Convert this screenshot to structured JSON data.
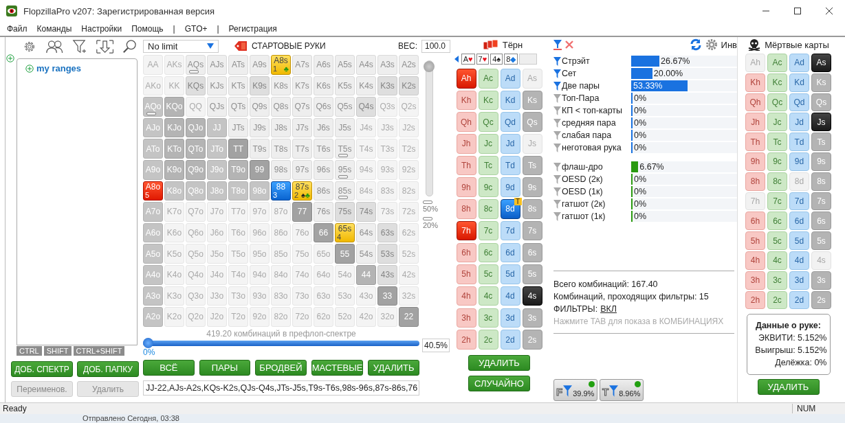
{
  "window": {
    "title": "FlopzillaPro v207: Зарегистрированная версия"
  },
  "menu": [
    "Файл",
    "Команды",
    "Настройки",
    "Помощь",
    "|",
    "GTO+",
    "|",
    "Регистрация"
  ],
  "range_panel": {
    "tree": [
      {
        "label": "my ranges"
      }
    ],
    "modifier_tabs": [
      "CTRL",
      "SHIFT",
      "CTRL+SHIFT"
    ],
    "buttons": [
      {
        "label": "ДОБ. СПЕКТР",
        "disabled": false
      },
      {
        "label": "ДОБ. ПАПКУ",
        "disabled": false
      },
      {
        "label": "Переименов.",
        "disabled": true
      },
      {
        "label": "Удалить",
        "disabled": true
      }
    ]
  },
  "grid": {
    "game": "No limit",
    "title": "СТАРТОВЫЕ РУКИ",
    "weight_label": "ВЕС:",
    "weight": "100.0",
    "weight_slider": {
      "level": 1,
      "marks": [
        "50%",
        "20%"
      ]
    },
    "rows": [
      [
        {
          "label": "AA",
          "kind": "faint",
          "marked": false
        },
        {
          "label": "AKs",
          "kind": "faint",
          "marked": false
        },
        {
          "label": "AQs",
          "kind": "light",
          "marked": true
        },
        {
          "label": "AJs",
          "kind": "light",
          "marked": false
        },
        {
          "label": "ATs",
          "kind": "light",
          "marked": false
        },
        {
          "label": "A9s",
          "kind": "light",
          "marked": false
        },
        {
          "label": "A8s",
          "kind": "yellow",
          "marked": false,
          "count": "1",
          "suits": [
            {
              "symbol": "♣",
              "color": "#2a9a10"
            }
          ]
        },
        {
          "label": "A7s",
          "kind": "light",
          "marked": false
        },
        {
          "label": "A6s",
          "kind": "light",
          "marked": false
        },
        {
          "label": "A5s",
          "kind": "light",
          "marked": false
        },
        {
          "label": "A4s",
          "kind": "light",
          "marked": false
        },
        {
          "label": "A3s",
          "kind": "light",
          "marked": false
        },
        {
          "label": "A2s",
          "kind": "light",
          "marked": false
        }
      ],
      [
        {
          "label": "AKo",
          "kind": "faint",
          "marked": false
        },
        {
          "label": "KK",
          "kind": "faint",
          "marked": false
        },
        {
          "label": "KQs",
          "kind": "shaded",
          "marked": false
        },
        {
          "label": "KJs",
          "kind": "light",
          "marked": false
        },
        {
          "label": "KTs",
          "kind": "light",
          "marked": false
        },
        {
          "label": "K9s",
          "kind": "shaded",
          "marked": false
        },
        {
          "label": "K8s",
          "kind": "light",
          "marked": false
        },
        {
          "label": "K7s",
          "kind": "light",
          "marked": false
        },
        {
          "label": "K6s",
          "kind": "light",
          "marked": false
        },
        {
          "label": "K5s",
          "kind": "light",
          "marked": false
        },
        {
          "label": "K4s",
          "kind": "light",
          "marked": false
        },
        {
          "label": "K3s",
          "kind": "shaded",
          "marked": false
        },
        {
          "label": "K2s",
          "kind": "shaded",
          "marked": false
        }
      ],
      [
        {
          "label": "AQo",
          "kind": "grey",
          "marked": true
        },
        {
          "label": "KQo",
          "kind": "dark",
          "marked": false
        },
        {
          "label": "QQ",
          "kind": "faint",
          "marked": false
        },
        {
          "label": "QJs",
          "kind": "light",
          "marked": false
        },
        {
          "label": "QTs",
          "kind": "light",
          "marked": false
        },
        {
          "label": "Q9s",
          "kind": "light",
          "marked": false
        },
        {
          "label": "Q8s",
          "kind": "light",
          "marked": false
        },
        {
          "label": "Q7s",
          "kind": "light",
          "marked": false
        },
        {
          "label": "Q6s",
          "kind": "light",
          "marked": false
        },
        {
          "label": "Q5s",
          "kind": "light",
          "marked": false
        },
        {
          "label": "Q4s",
          "kind": "shaded",
          "marked": false
        },
        {
          "label": "Q3s",
          "kind": "faint",
          "marked": false
        },
        {
          "label": "Q2s",
          "kind": "faint",
          "marked": false
        }
      ],
      [
        {
          "label": "AJo",
          "kind": "grey",
          "marked": false
        },
        {
          "label": "KJo",
          "kind": "dark",
          "marked": false
        },
        {
          "label": "QJo",
          "kind": "dark",
          "marked": false
        },
        {
          "label": "JJ",
          "kind": "grey",
          "marked": false
        },
        {
          "label": "JTs",
          "kind": "light",
          "marked": false
        },
        {
          "label": "J9s",
          "kind": "light",
          "marked": false
        },
        {
          "label": "J8s",
          "kind": "light",
          "marked": false
        },
        {
          "label": "J7s",
          "kind": "light",
          "marked": false
        },
        {
          "label": "J6s",
          "kind": "light",
          "marked": false
        },
        {
          "label": "J5s",
          "kind": "light",
          "marked": false
        },
        {
          "label": "J4s",
          "kind": "faint",
          "marked": false
        },
        {
          "label": "J3s",
          "kind": "faint",
          "marked": false
        },
        {
          "label": "J2s",
          "kind": "faint",
          "marked": false
        }
      ],
      [
        {
          "label": "ATo",
          "kind": "grey",
          "marked": false
        },
        {
          "label": "KTo",
          "kind": "dark",
          "marked": false
        },
        {
          "label": "QTo",
          "kind": "dark",
          "marked": false
        },
        {
          "label": "JTo",
          "kind": "grey",
          "marked": false
        },
        {
          "label": "TT",
          "kind": "darker",
          "marked": false
        },
        {
          "label": "T9s",
          "kind": "light",
          "marked": false
        },
        {
          "label": "T8s",
          "kind": "light",
          "marked": false
        },
        {
          "label": "T7s",
          "kind": "light",
          "marked": false
        },
        {
          "label": "T6s",
          "kind": "light",
          "marked": false
        },
        {
          "label": "T5s",
          "kind": "light",
          "marked": true
        },
        {
          "label": "T4s",
          "kind": "faint",
          "marked": false
        },
        {
          "label": "T3s",
          "kind": "faint",
          "marked": false
        },
        {
          "label": "T2s",
          "kind": "faint",
          "marked": false
        }
      ],
      [
        {
          "label": "A9o",
          "kind": "grey",
          "marked": false
        },
        {
          "label": "K9o",
          "kind": "dark",
          "marked": false
        },
        {
          "label": "Q9o",
          "kind": "dark",
          "marked": false
        },
        {
          "label": "J9o",
          "kind": "grey",
          "marked": false
        },
        {
          "label": "T9o",
          "kind": "dark",
          "marked": false
        },
        {
          "label": "99",
          "kind": "darker",
          "marked": false
        },
        {
          "label": "98s",
          "kind": "light",
          "marked": false
        },
        {
          "label": "97s",
          "kind": "light",
          "marked": false
        },
        {
          "label": "96s",
          "kind": "light",
          "marked": false
        },
        {
          "label": "95s",
          "kind": "light",
          "marked": true
        },
        {
          "label": "94s",
          "kind": "faint",
          "marked": false
        },
        {
          "label": "93s",
          "kind": "faint",
          "marked": false
        },
        {
          "label": "92s",
          "kind": "faint",
          "marked": false
        }
      ],
      [
        {
          "label": "A8o",
          "kind": "red",
          "marked": false,
          "count": "5"
        },
        {
          "label": "K8o",
          "kind": "grey",
          "marked": false
        },
        {
          "label": "Q8o",
          "kind": "grey",
          "marked": false
        },
        {
          "label": "J8o",
          "kind": "grey",
          "marked": false
        },
        {
          "label": "T8o",
          "kind": "grey",
          "marked": false
        },
        {
          "label": "98o",
          "kind": "grey",
          "marked": false
        },
        {
          "label": "88",
          "kind": "blue",
          "marked": false,
          "count": "3"
        },
        {
          "label": "87s",
          "kind": "yellow",
          "marked": false,
          "count": "2",
          "suits": [
            {
              "symbol": "♠",
              "color": "#222222"
            },
            {
              "symbol": "♣",
              "color": "#2a9a10"
            }
          ]
        },
        {
          "label": "86s",
          "kind": "light",
          "marked": false
        },
        {
          "label": "85s",
          "kind": "light",
          "marked": true
        },
        {
          "label": "84s",
          "kind": "faint",
          "marked": false
        },
        {
          "label": "83s",
          "kind": "faint",
          "marked": false
        },
        {
          "label": "82s",
          "kind": "faint",
          "marked": false
        }
      ],
      [
        {
          "label": "A7o",
          "kind": "grey",
          "marked": false
        },
        {
          "label": "K7o",
          "kind": "faint",
          "marked": false
        },
        {
          "label": "Q7o",
          "kind": "faint",
          "marked": false
        },
        {
          "label": "J7o",
          "kind": "faint",
          "marked": false
        },
        {
          "label": "T7o",
          "kind": "faint",
          "marked": false
        },
        {
          "label": "97o",
          "kind": "faint",
          "marked": false
        },
        {
          "label": "87o",
          "kind": "faint",
          "marked": false
        },
        {
          "label": "77",
          "kind": "darker",
          "marked": false
        },
        {
          "label": "76s",
          "kind": "light",
          "marked": false
        },
        {
          "label": "75s",
          "kind": "shaded",
          "marked": false
        },
        {
          "label": "74s",
          "kind": "shaded",
          "marked": false
        },
        {
          "label": "73s",
          "kind": "faint",
          "marked": false
        },
        {
          "label": "72s",
          "kind": "faint",
          "marked": false
        }
      ],
      [
        {
          "label": "A6o",
          "kind": "grey",
          "marked": false
        },
        {
          "label": "K6o",
          "kind": "faint",
          "marked": false
        },
        {
          "label": "Q6o",
          "kind": "faint",
          "marked": false
        },
        {
          "label": "J6o",
          "kind": "faint",
          "marked": false
        },
        {
          "label": "T6o",
          "kind": "faint",
          "marked": false
        },
        {
          "label": "96o",
          "kind": "faint",
          "marked": false
        },
        {
          "label": "86o",
          "kind": "faint",
          "marked": false
        },
        {
          "label": "76o",
          "kind": "faint",
          "marked": false
        },
        {
          "label": "66",
          "kind": "darker",
          "marked": false
        },
        {
          "label": "65s",
          "kind": "yellow",
          "marked": false,
          "count": "4"
        },
        {
          "label": "64s",
          "kind": "light",
          "marked": false
        },
        {
          "label": "63s",
          "kind": "shaded",
          "marked": false
        },
        {
          "label": "62s",
          "kind": "faint",
          "marked": false
        }
      ],
      [
        {
          "label": "A5o",
          "kind": "grey",
          "marked": false
        },
        {
          "label": "K5o",
          "kind": "faint",
          "marked": false
        },
        {
          "label": "Q5o",
          "kind": "faint",
          "marked": false
        },
        {
          "label": "J5o",
          "kind": "faint",
          "marked": false
        },
        {
          "label": "T5o",
          "kind": "faint",
          "marked": false
        },
        {
          "label": "95o",
          "kind": "faint",
          "marked": false
        },
        {
          "label": "85o",
          "kind": "faint",
          "marked": false
        },
        {
          "label": "75o",
          "kind": "faint",
          "marked": false
        },
        {
          "label": "65o",
          "kind": "faint",
          "marked": false
        },
        {
          "label": "55",
          "kind": "darker",
          "marked": false
        },
        {
          "label": "54s",
          "kind": "light",
          "marked": false
        },
        {
          "label": "53s",
          "kind": "shaded",
          "marked": false
        },
        {
          "label": "52s",
          "kind": "faint",
          "marked": false
        }
      ],
      [
        {
          "label": "A4o",
          "kind": "grey",
          "marked": false
        },
        {
          "label": "K4o",
          "kind": "faint",
          "marked": false
        },
        {
          "label": "Q4o",
          "kind": "faint",
          "marked": false
        },
        {
          "label": "J4o",
          "kind": "faint",
          "marked": false
        },
        {
          "label": "T4o",
          "kind": "faint",
          "marked": false
        },
        {
          "label": "94o",
          "kind": "faint",
          "marked": false
        },
        {
          "label": "84o",
          "kind": "faint",
          "marked": false
        },
        {
          "label": "74o",
          "kind": "faint",
          "marked": false
        },
        {
          "label": "64o",
          "kind": "faint",
          "marked": false
        },
        {
          "label": "54o",
          "kind": "faint",
          "marked": false
        },
        {
          "label": "44",
          "kind": "dark",
          "marked": false
        },
        {
          "label": "43s",
          "kind": "shaded",
          "marked": false
        },
        {
          "label": "42s",
          "kind": "faint",
          "marked": false
        }
      ],
      [
        {
          "label": "A3o",
          "kind": "grey",
          "marked": false
        },
        {
          "label": "K3o",
          "kind": "faint",
          "marked": false
        },
        {
          "label": "Q3o",
          "kind": "faint",
          "marked": false
        },
        {
          "label": "J3o",
          "kind": "faint",
          "marked": false
        },
        {
          "label": "T3o",
          "kind": "faint",
          "marked": false
        },
        {
          "label": "93o",
          "kind": "faint",
          "marked": false
        },
        {
          "label": "83o",
          "kind": "faint",
          "marked": false
        },
        {
          "label": "73o",
          "kind": "faint",
          "marked": false
        },
        {
          "label": "63o",
          "kind": "faint",
          "marked": false
        },
        {
          "label": "53o",
          "kind": "faint",
          "marked": false
        },
        {
          "label": "43o",
          "kind": "faint",
          "marked": false
        },
        {
          "label": "33",
          "kind": "darker",
          "marked": false
        },
        {
          "label": "32s",
          "kind": "faint",
          "marked": false
        }
      ],
      [
        {
          "label": "A2o",
          "kind": "grey",
          "marked": false
        },
        {
          "label": "K2o",
          "kind": "faint",
          "marked": false
        },
        {
          "label": "Q2o",
          "kind": "faint",
          "marked": false
        },
        {
          "label": "J2o",
          "kind": "faint",
          "marked": false
        },
        {
          "label": "T2o",
          "kind": "faint",
          "marked": false
        },
        {
          "label": "92o",
          "kind": "faint",
          "marked": false
        },
        {
          "label": "82o",
          "kind": "faint",
          "marked": false
        },
        {
          "label": "72o",
          "kind": "faint",
          "marked": false
        },
        {
          "label": "62o",
          "kind": "faint",
          "marked": false
        },
        {
          "label": "52o",
          "kind": "faint",
          "marked": false
        },
        {
          "label": "42o",
          "kind": "faint",
          "marked": false
        },
        {
          "label": "32o",
          "kind": "faint",
          "marked": false
        },
        {
          "label": "22",
          "kind": "darker",
          "marked": false
        }
      ]
    ],
    "combos_caption": "419.20 комбинаций в префлоп-спектре",
    "range_slider": {
      "level": 0,
      "min_label": "0%"
    },
    "percent": "40.5%",
    "buttons": [
      "ВСЁ",
      "ПАРЫ",
      "БРОДВЕЙ",
      "МАСТЕВЫЕ",
      "УДАЛИТЬ"
    ],
    "range_text": "JJ-22,AJs-A2s,KQs-K2s,QJs-Q4s,JTs-J5s,T9s-T6s,98s-96s,87s-86s,76"
  },
  "turn": {
    "title": "Тёрн",
    "board": [
      {
        "kind": "card",
        "rank": "A",
        "symbol": "♥",
        "color": "#e8101c"
      },
      {
        "kind": "card",
        "rank": "7",
        "symbol": "♥",
        "color": "#e8101c"
      },
      {
        "kind": "card",
        "rank": "4",
        "symbol": "♠",
        "color": "#222222"
      },
      {
        "kind": "card",
        "rank": "8",
        "symbol": "◆",
        "color": "#1a78e0"
      },
      {
        "kind": "empty"
      }
    ],
    "columns": [
      {
        "kind": "hearts",
        "cards": [
          {
            "label": "Ah",
            "picked": true,
            "blocked": false
          },
          {
            "label": "Kh",
            "picked": false,
            "blocked": false
          },
          {
            "label": "Qh",
            "picked": false,
            "blocked": false
          },
          {
            "label": "Jh",
            "picked": false,
            "blocked": false
          },
          {
            "label": "Th",
            "picked": false,
            "blocked": false
          },
          {
            "label": "9h",
            "picked": false,
            "blocked": false
          },
          {
            "label": "8h",
            "picked": false,
            "blocked": false
          },
          {
            "label": "7h",
            "picked": true,
            "blocked": false
          },
          {
            "label": "6h",
            "picked": false,
            "blocked": false
          },
          {
            "label": "5h",
            "picked": false,
            "blocked": false
          },
          {
            "label": "4h",
            "picked": false,
            "blocked": false
          },
          {
            "label": "3h",
            "picked": false,
            "blocked": false
          },
          {
            "label": "2h",
            "picked": false,
            "blocked": false
          }
        ]
      },
      {
        "kind": "clubs",
        "cards": [
          {
            "label": "Ac",
            "picked": false,
            "blocked": false
          },
          {
            "label": "Kc",
            "picked": false,
            "blocked": false
          },
          {
            "label": "Qc",
            "picked": false,
            "blocked": false
          },
          {
            "label": "Jc",
            "picked": false,
            "blocked": false
          },
          {
            "label": "Tc",
            "picked": false,
            "blocked": false
          },
          {
            "label": "9c",
            "picked": false,
            "blocked": false
          },
          {
            "label": "8c",
            "picked": false,
            "blocked": false
          },
          {
            "label": "7c",
            "picked": false,
            "blocked": false
          },
          {
            "label": "6c",
            "picked": false,
            "blocked": false
          },
          {
            "label": "5c",
            "picked": false,
            "blocked": false
          },
          {
            "label": "4c",
            "picked": false,
            "blocked": false
          },
          {
            "label": "3c",
            "picked": false,
            "blocked": false
          },
          {
            "label": "2c",
            "picked": false,
            "blocked": false
          }
        ]
      },
      {
        "kind": "diamonds",
        "cards": [
          {
            "label": "Ad",
            "picked": false,
            "blocked": false
          },
          {
            "label": "Kd",
            "picked": false,
            "blocked": false
          },
          {
            "label": "Qd",
            "picked": false,
            "blocked": false
          },
          {
            "label": "Jd",
            "picked": false,
            "blocked": false
          },
          {
            "label": "Td",
            "picked": false,
            "blocked": false
          },
          {
            "label": "9d",
            "picked": false,
            "blocked": false
          },
          {
            "label": "8d",
            "picked": true,
            "blocked": false,
            "badge": "T"
          },
          {
            "label": "7d",
            "picked": false,
            "blocked": false
          },
          {
            "label": "6d",
            "picked": false,
            "blocked": false
          },
          {
            "label": "5d",
            "picked": false,
            "blocked": false
          },
          {
            "label": "4d",
            "picked": false,
            "blocked": false
          },
          {
            "label": "3d",
            "picked": false,
            "blocked": false
          },
          {
            "label": "2d",
            "picked": false,
            "blocked": false
          }
        ]
      },
      {
        "kind": "spades",
        "cards": [
          {
            "label": "As",
            "picked": false,
            "blocked": true
          },
          {
            "label": "Ks",
            "picked": false,
            "blocked": false
          },
          {
            "label": "Qs",
            "picked": false,
            "blocked": false
          },
          {
            "label": "Js",
            "picked": false,
            "blocked": true
          },
          {
            "label": "Ts",
            "picked": false,
            "blocked": false
          },
          {
            "label": "9s",
            "picked": false,
            "blocked": false
          },
          {
            "label": "8s",
            "picked": false,
            "blocked": false
          },
          {
            "label": "7s",
            "picked": false,
            "blocked": false
          },
          {
            "label": "6s",
            "picked": false,
            "blocked": false
          },
          {
            "label": "5s",
            "picked": false,
            "blocked": false
          },
          {
            "label": "4s",
            "picked": true,
            "blocked": false
          },
          {
            "label": "3s",
            "picked": false,
            "blocked": false
          },
          {
            "label": "2s",
            "picked": false,
            "blocked": false
          }
        ]
      }
    ],
    "buttons": [
      "УДАЛИТЬ",
      "СЛУЧАЙНО"
    ]
  },
  "stats": {
    "invert_label": "Инв",
    "groups": [
      {
        "color": "#1a72e0",
        "items": [
          {
            "label": "Стрэйт",
            "filter_on": true,
            "level": 0.2667,
            "value": "26.67%"
          },
          {
            "label": "Сет",
            "filter_on": true,
            "level": 0.2,
            "value": "20.00%"
          },
          {
            "label": "Две пары",
            "filter_on": true,
            "level": 0.5333,
            "value": "53.33%"
          },
          {
            "label": "Топ-Пара",
            "filter_on": false,
            "level": 0,
            "value": "0%"
          },
          {
            "label": "КП < топ-карты",
            "filter_on": false,
            "level": 0,
            "value": "0%"
          },
          {
            "label": "средняя пара",
            "filter_on": false,
            "level": 0,
            "value": "0%"
          },
          {
            "label": "слабая пара",
            "filter_on": false,
            "level": 0,
            "value": "0%"
          },
          {
            "label": "неготовая рука",
            "filter_on": false,
            "level": 0,
            "value": "0%"
          }
        ]
      },
      {
        "color": "#2a9a10",
        "items": [
          {
            "label": "флаш-дро",
            "filter_on": false,
            "level": 0.0667,
            "value": "6.67%"
          },
          {
            "label": "OESD (2к)",
            "filter_on": false,
            "level": 0,
            "value": "0%"
          },
          {
            "label": "OESD (1к)",
            "filter_on": false,
            "level": 0,
            "value": "0%"
          },
          {
            "label": "гатшот (2к)",
            "filter_on": false,
            "level": 0,
            "value": "0%"
          },
          {
            "label": "гатшот (1к)",
            "filter_on": false,
            "level": 0,
            "value": "0%"
          }
        ]
      }
    ],
    "total": "Всего комбинаций: 167.40",
    "passing": "Комбинаций, проходящих фильтры: 15",
    "filters_label": "ФИЛЬТРЫ:",
    "filters_link": "ВКЛ",
    "hint": "Нажмите TAB для показа в КОМБИНАЦИЯХ",
    "chips": [
      {
        "letter": "F",
        "value": "39.9%",
        "on": true
      },
      {
        "letter": "T",
        "value": "8.96%",
        "on": true
      }
    ]
  },
  "dead": {
    "title": "Мёртвые карты",
    "columns": [
      {
        "kind": "hearts",
        "cards": [
          {
            "label": "Ah",
            "picked": false,
            "blocked": true
          },
          {
            "label": "Kh",
            "picked": false,
            "blocked": false
          },
          {
            "label": "Qh",
            "picked": false,
            "blocked": false
          },
          {
            "label": "Jh",
            "picked": false,
            "blocked": false
          },
          {
            "label": "Th",
            "picked": false,
            "blocked": false
          },
          {
            "label": "9h",
            "picked": false,
            "blocked": false
          },
          {
            "label": "8h",
            "picked": false,
            "blocked": false
          },
          {
            "label": "7h",
            "picked": false,
            "blocked": true
          },
          {
            "label": "6h",
            "picked": false,
            "blocked": false
          },
          {
            "label": "5h",
            "picked": false,
            "blocked": false
          },
          {
            "label": "4h",
            "picked": false,
            "blocked": false
          },
          {
            "label": "3h",
            "picked": false,
            "blocked": false
          },
          {
            "label": "2h",
            "picked": false,
            "blocked": false
          }
        ]
      },
      {
        "kind": "clubs",
        "cards": [
          {
            "label": "Ac",
            "picked": false,
            "blocked": false
          },
          {
            "label": "Kc",
            "picked": false,
            "blocked": false
          },
          {
            "label": "Qc",
            "picked": false,
            "blocked": false
          },
          {
            "label": "Jc",
            "picked": false,
            "blocked": false
          },
          {
            "label": "Tc",
            "picked": false,
            "blocked": false
          },
          {
            "label": "9c",
            "picked": false,
            "blocked": false
          },
          {
            "label": "8c",
            "picked": false,
            "blocked": false
          },
          {
            "label": "7c",
            "picked": false,
            "blocked": false
          },
          {
            "label": "6c",
            "picked": false,
            "blocked": false
          },
          {
            "label": "5c",
            "picked": false,
            "blocked": false
          },
          {
            "label": "4c",
            "picked": false,
            "blocked": false
          },
          {
            "label": "3c",
            "picked": false,
            "blocked": false
          },
          {
            "label": "2c",
            "picked": false,
            "blocked": false
          }
        ]
      },
      {
        "kind": "diamonds",
        "cards": [
          {
            "label": "Ad",
            "picked": false,
            "blocked": false
          },
          {
            "label": "Kd",
            "picked": false,
            "blocked": false
          },
          {
            "label": "Qd",
            "picked": false,
            "blocked": false
          },
          {
            "label": "Jd",
            "picked": false,
            "blocked": false
          },
          {
            "label": "Td",
            "picked": false,
            "blocked": false
          },
          {
            "label": "9d",
            "picked": false,
            "blocked": false
          },
          {
            "label": "8d",
            "picked": false,
            "blocked": true
          },
          {
            "label": "7d",
            "picked": false,
            "blocked": false
          },
          {
            "label": "6d",
            "picked": false,
            "blocked": false
          },
          {
            "label": "5d",
            "picked": false,
            "blocked": false
          },
          {
            "label": "4d",
            "picked": false,
            "blocked": false
          },
          {
            "label": "3d",
            "picked": false,
            "blocked": false
          },
          {
            "label": "2d",
            "picked": false,
            "blocked": false
          }
        ]
      },
      {
        "kind": "spades",
        "cards": [
          {
            "label": "As",
            "picked": true,
            "blocked": false
          },
          {
            "label": "Ks",
            "picked": false,
            "blocked": false
          },
          {
            "label": "Qs",
            "picked": false,
            "blocked": false
          },
          {
            "label": "Js",
            "picked": true,
            "blocked": false
          },
          {
            "label": "Ts",
            "picked": false,
            "blocked": false
          },
          {
            "label": "9s",
            "picked": false,
            "blocked": false
          },
          {
            "label": "8s",
            "picked": false,
            "blocked": false
          },
          {
            "label": "7s",
            "picked": false,
            "blocked": false
          },
          {
            "label": "6s",
            "picked": false,
            "blocked": false
          },
          {
            "label": "5s",
            "picked": false,
            "blocked": false
          },
          {
            "label": "4s",
            "picked": false,
            "blocked": true
          },
          {
            "label": "3s",
            "picked": false,
            "blocked": false
          },
          {
            "label": "2s",
            "picked": false,
            "blocked": false
          }
        ]
      }
    ],
    "hand_title": "Данные о руке:",
    "hand_lines": [
      "ЭКВИТИ: 5.152%",
      "Выигрыш: 5.152%",
      "Делёжка: 0%"
    ],
    "button": "УДАЛИТЬ"
  },
  "status_bar": [
    "Ready",
    "NUM"
  ],
  "background_window": {
    "text": "Отправлено Сегодня, 03:38"
  }
}
